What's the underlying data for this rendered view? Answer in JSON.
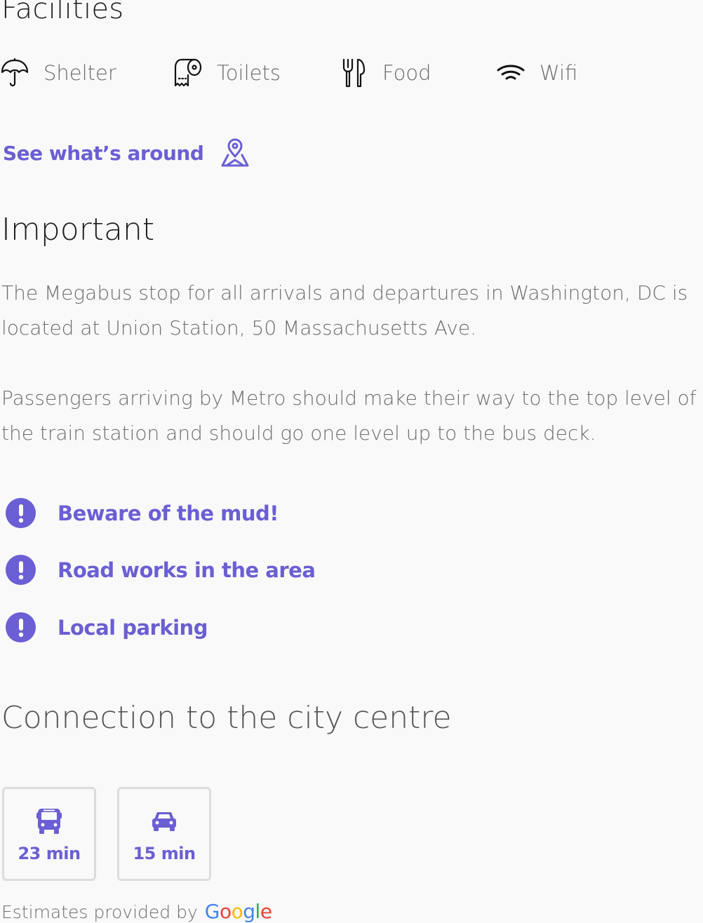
{
  "facilities": {
    "title": "Facilities",
    "items": [
      {
        "label": "Shelter",
        "icon": "umbrella-icon"
      },
      {
        "label": "Toilets",
        "icon": "toilet-paper-icon"
      },
      {
        "label": "Food",
        "icon": "fork-knife-icon"
      },
      {
        "label": "Wifi",
        "icon": "wifi-icon"
      }
    ]
  },
  "see_around": {
    "label": "See what’s around",
    "icon": "map-pin-icon"
  },
  "important": {
    "title": "Important",
    "paragraphs": [
      "The Megabus stop for all arrivals and departures in Washington, DC is located at Union Station, 50 Massachusetts Ave.",
      "Passengers arriving by Metro should make their way to the top level of the train station and should go one level up to the bus deck."
    ]
  },
  "notices": [
    {
      "label": "Beware of the mud!",
      "icon": "exclamation-icon"
    },
    {
      "label": "Road works in the area",
      "icon": "exclamation-icon"
    },
    {
      "label": "Local parking",
      "icon": "exclamation-icon"
    }
  ],
  "connection": {
    "title": "Connection to the city centre",
    "options": [
      {
        "mode": "bus",
        "icon": "bus-icon",
        "time": "23 min"
      },
      {
        "mode": "car",
        "icon": "car-icon",
        "time": "15 min"
      }
    ],
    "estimates_label": "Estimates provided by",
    "provider": "Google"
  },
  "colors": {
    "accent": "#6a5fd4",
    "text_muted": "#6e6e6e",
    "heading": "#1e1e1e",
    "background": "#f9f9f9"
  }
}
